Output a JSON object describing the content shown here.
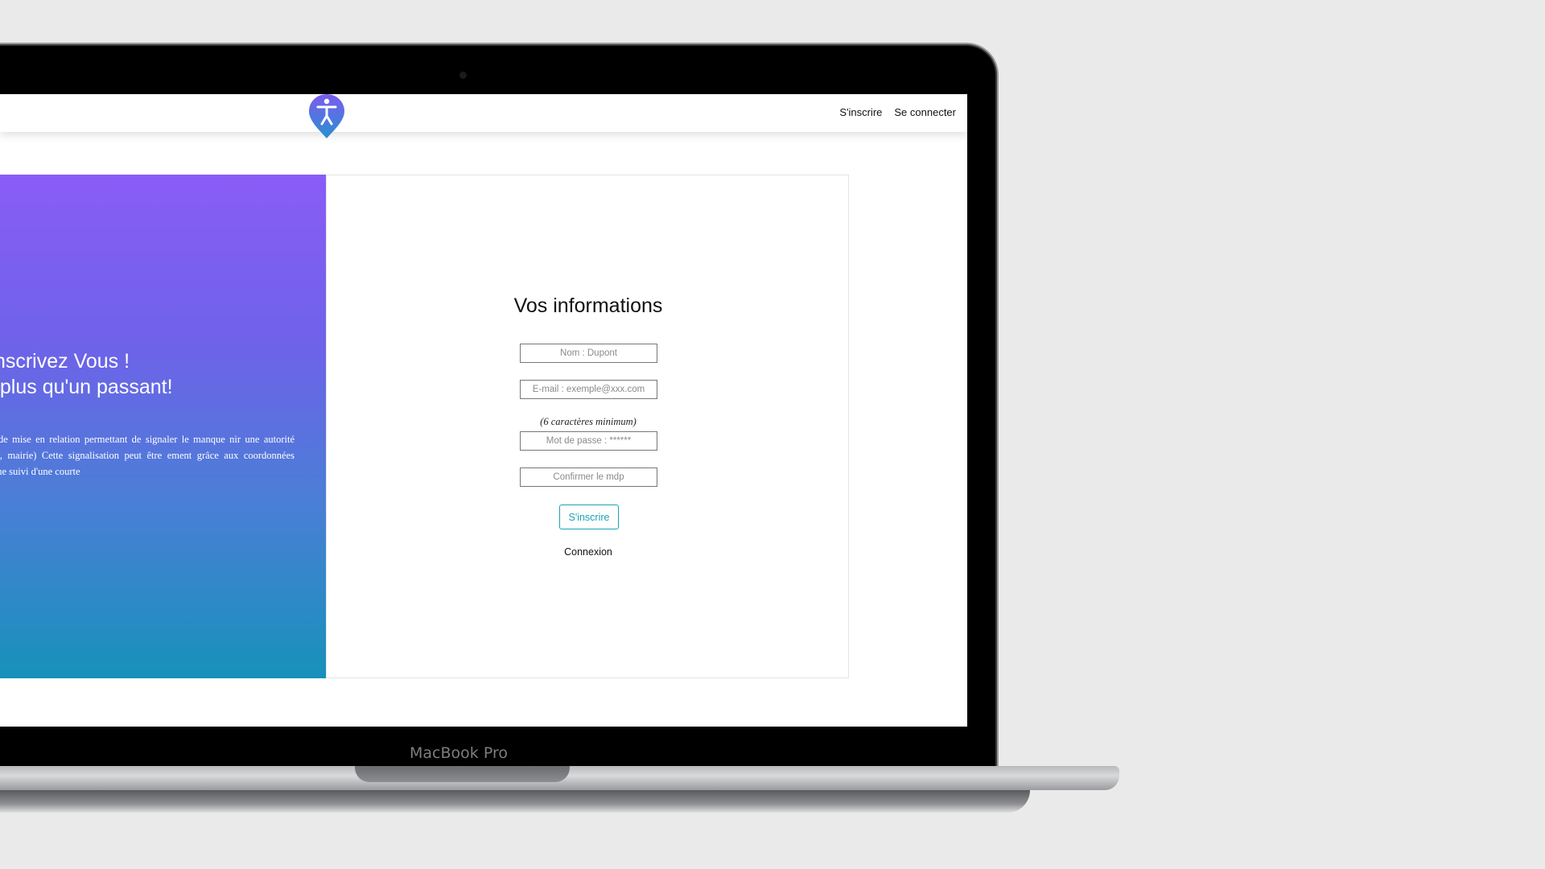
{
  "device": {
    "label": "MacBook Pro"
  },
  "nav": {
    "links": [
      {
        "label": "S'inscrire"
      },
      {
        "label": "Se connecter"
      }
    ],
    "logo_icon": "accessibility-pin-icon"
  },
  "hero": {
    "title_line1": "Inscrivez Vous !",
    "title_line2": "t plus qu'un passant!",
    "description": "on mobile de mise en relation permettant de signaler le manque nir une autorité (association, mairie) Cette signalisation peut être ement grâce aux coordonnées géographique suivi d'une courte"
  },
  "form": {
    "title": "Vos informations",
    "fields": [
      {
        "placeholder": "Nom : Dupont",
        "value": ""
      },
      {
        "placeholder": "E-mail : exemple@xxx.com",
        "value": ""
      },
      {
        "placeholder": "Mot de passe : ******",
        "value": ""
      },
      {
        "placeholder": "Confirmer le mdp",
        "value": ""
      }
    ],
    "password_hint": "(6 caractères minimum)",
    "submit_label": "S'inscrire",
    "login_link": "Connexion"
  },
  "colors": {
    "gradient_top": "#8a5cf7",
    "gradient_bottom": "#1791ba",
    "accent": "#1aa3b3"
  }
}
